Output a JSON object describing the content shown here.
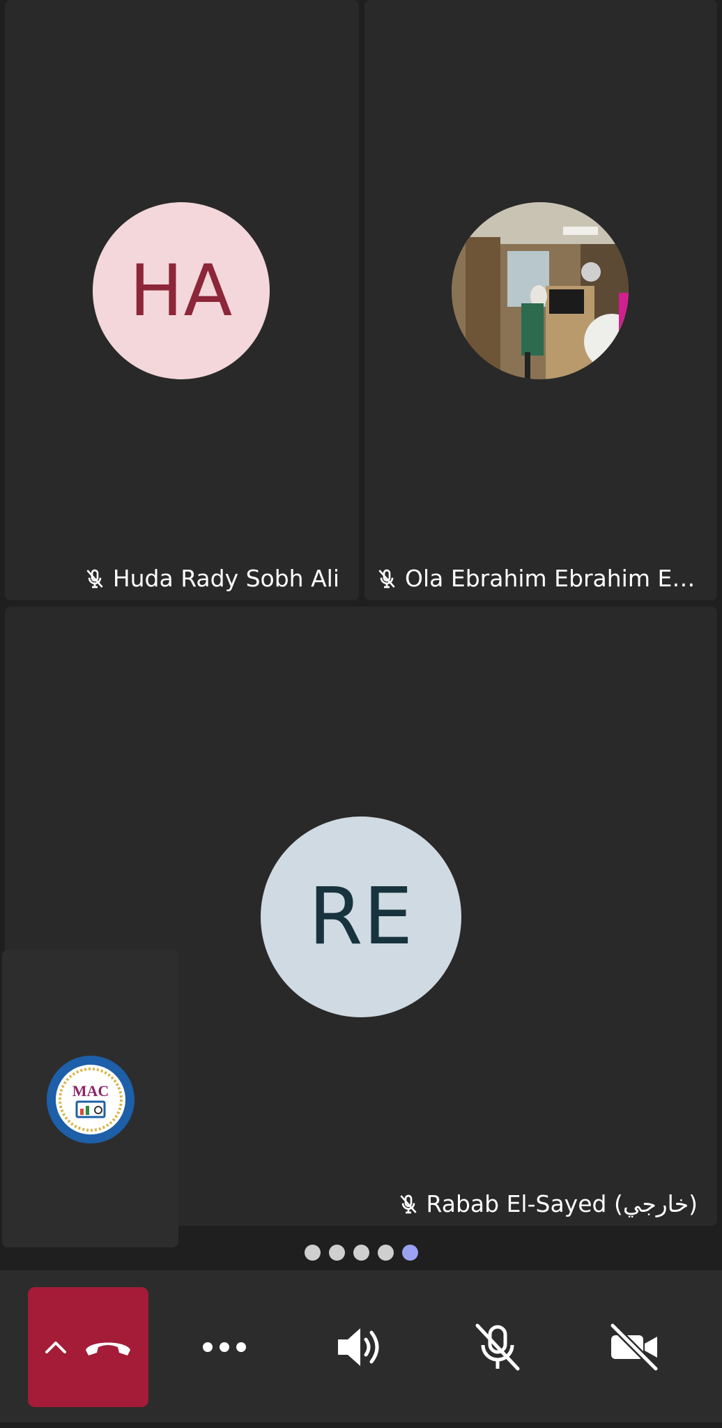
{
  "participants": [
    {
      "initials": "HA",
      "name": "Huda Rady Sobh Ali",
      "muted": true,
      "avatar_bg": "#f4d7da",
      "avatar_fg": "#8c2638"
    },
    {
      "initials": "",
      "name": "Ola Ebrahim Ebrahim El-S...",
      "muted": true,
      "avatar": "photo"
    },
    {
      "initials": "RE",
      "name": "Rabab El-Sayed (خارجي)",
      "muted": true,
      "avatar_bg": "#d0dae2",
      "avatar_fg": "#17333d"
    }
  ],
  "self_view": {
    "logo_text": "MAC"
  },
  "pagination": {
    "total_pages": 5,
    "active_page": 5
  },
  "controls": {
    "end_call_icon": "phone-hangup-icon",
    "expand_icon": "chevron-up-icon",
    "more_icon": "more-dots-icon",
    "speaker_icon": "speaker-icon",
    "mic_icon": "mic-off-icon",
    "camera_icon": "video-off-icon"
  },
  "colors": {
    "end_call": "#a41c37",
    "active_dot": "#9ba2f2",
    "inactive_dot": "#cfcfcf"
  }
}
